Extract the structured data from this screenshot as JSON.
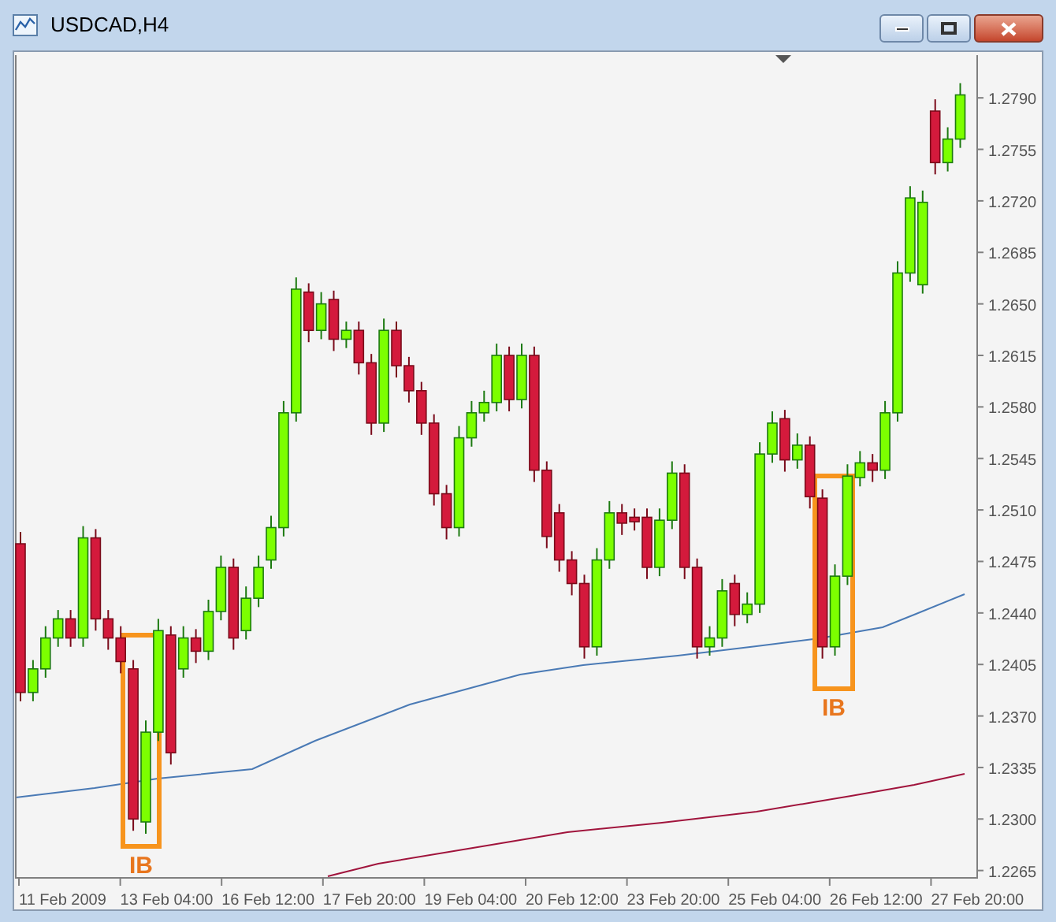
{
  "window": {
    "title": "USDCAD,H4"
  },
  "chart_data": {
    "type": "candlestick",
    "ylim": [
      1.226,
      1.2819
    ],
    "yticks": [
      {
        "value": 1.279,
        "label": "1.2790"
      },
      {
        "value": 1.2755,
        "label": "1.2755"
      },
      {
        "value": 1.272,
        "label": "1.2720"
      },
      {
        "value": 1.2685,
        "label": "1.2685"
      },
      {
        "value": 1.265,
        "label": "1.2650"
      },
      {
        "value": 1.2615,
        "label": "1.2615"
      },
      {
        "value": 1.258,
        "label": "1.2580"
      },
      {
        "value": 1.2545,
        "label": "1.2545"
      },
      {
        "value": 1.251,
        "label": "1.2510"
      },
      {
        "value": 1.2475,
        "label": "1.2475"
      },
      {
        "value": 1.244,
        "label": "1.2440"
      },
      {
        "value": 1.2405,
        "label": "1.2405"
      },
      {
        "value": 1.237,
        "label": "1.2370"
      },
      {
        "value": 1.2335,
        "label": "1.2335"
      },
      {
        "value": 1.23,
        "label": "1.2300"
      },
      {
        "value": 1.2265,
        "label": "1.2265"
      }
    ],
    "ohlc": [
      [
        1.2487,
        1.2495,
        1.238,
        1.2386
      ],
      [
        1.2386,
        1.2408,
        1.238,
        1.2402
      ],
      [
        1.2402,
        1.2431,
        1.2396,
        1.2423
      ],
      [
        1.2423,
        1.2442,
        1.2417,
        1.2436
      ],
      [
        1.2436,
        1.2442,
        1.2417,
        1.2423
      ],
      [
        1.2423,
        1.2499,
        1.2417,
        1.2491
      ],
      [
        1.2491,
        1.2497,
        1.2428,
        1.2436
      ],
      [
        1.2436,
        1.2442,
        1.2415,
        1.2423
      ],
      [
        1.2423,
        1.2431,
        1.2399,
        1.2407
      ],
      [
        1.2402,
        1.2408,
        1.2292,
        1.23
      ],
      [
        1.2298,
        1.2367,
        1.229,
        1.2359
      ],
      [
        1.2359,
        1.2436,
        1.2353,
        1.2428
      ],
      [
        1.2425,
        1.2431,
        1.2337,
        1.2345
      ],
      [
        1.2402,
        1.2431,
        1.2396,
        1.2423
      ],
      [
        1.2423,
        1.2429,
        1.2406,
        1.2414
      ],
      [
        1.2414,
        1.2449,
        1.2408,
        1.2441
      ],
      [
        1.2441,
        1.2479,
        1.2435,
        1.2471
      ],
      [
        1.2471,
        1.2477,
        1.2415,
        1.2423
      ],
      [
        1.2428,
        1.2458,
        1.2422,
        1.245
      ],
      [
        1.245,
        1.2479,
        1.2444,
        1.2471
      ],
      [
        1.2476,
        1.2506,
        1.247,
        1.2498
      ],
      [
        1.2498,
        1.2584,
        1.2492,
        1.2576
      ],
      [
        1.2576,
        1.2668,
        1.257,
        1.266
      ],
      [
        1.2658,
        1.2664,
        1.2624,
        1.2632
      ],
      [
        1.2632,
        1.2658,
        1.2626,
        1.265
      ],
      [
        1.2653,
        1.2659,
        1.2618,
        1.2626
      ],
      [
        1.2626,
        1.2638,
        1.262,
        1.2632
      ],
      [
        1.2632,
        1.2638,
        1.2602,
        1.261
      ],
      [
        1.261,
        1.2616,
        1.2561,
        1.2569
      ],
      [
        1.2569,
        1.264,
        1.2563,
        1.2632
      ],
      [
        1.2632,
        1.2638,
        1.26,
        1.2608
      ],
      [
        1.2608,
        1.2614,
        1.2583,
        1.2591
      ],
      [
        1.2591,
        1.2597,
        1.2561,
        1.2569
      ],
      [
        1.2569,
        1.2575,
        1.2513,
        1.2521
      ],
      [
        1.2521,
        1.2527,
        1.249,
        1.2498
      ],
      [
        1.2498,
        1.2567,
        1.2492,
        1.2559
      ],
      [
        1.2559,
        1.2584,
        1.2553,
        1.2576
      ],
      [
        1.2576,
        1.2591,
        1.257,
        1.2583
      ],
      [
        1.2583,
        1.2623,
        1.2577,
        1.2615
      ],
      [
        1.2615,
        1.2621,
        1.2577,
        1.2585
      ],
      [
        1.2585,
        1.2623,
        1.2579,
        1.2615
      ],
      [
        1.2615,
        1.2621,
        1.2529,
        1.2537
      ],
      [
        1.2537,
        1.2543,
        1.2484,
        1.2492
      ],
      [
        1.2508,
        1.2514,
        1.2468,
        1.2476
      ],
      [
        1.2476,
        1.2482,
        1.2452,
        1.246
      ],
      [
        1.246,
        1.2466,
        1.2409,
        1.2417
      ],
      [
        1.2417,
        1.2484,
        1.2411,
        1.2476
      ],
      [
        1.2476,
        1.2516,
        1.247,
        1.2508
      ],
      [
        1.2508,
        1.2514,
        1.2493,
        1.2501
      ],
      [
        1.2505,
        1.2511,
        1.2496,
        1.2502
      ],
      [
        1.2505,
        1.2511,
        1.2463,
        1.2471
      ],
      [
        1.2471,
        1.2511,
        1.2465,
        1.2503
      ],
      [
        1.2503,
        1.2543,
        1.2497,
        1.2535
      ],
      [
        1.2535,
        1.2541,
        1.2463,
        1.2471
      ],
      [
        1.2471,
        1.2477,
        1.2409,
        1.2417
      ],
      [
        1.2417,
        1.2431,
        1.2411,
        1.2423
      ],
      [
        1.2423,
        1.2463,
        1.2417,
        1.2455
      ],
      [
        1.246,
        1.2466,
        1.2431,
        1.2439
      ],
      [
        1.2439,
        1.2454,
        1.2433,
        1.2446
      ],
      [
        1.2446,
        1.2556,
        1.244,
        1.2548
      ],
      [
        1.2548,
        1.2577,
        1.2542,
        1.2569
      ],
      [
        1.2572,
        1.2578,
        1.2536,
        1.2544
      ],
      [
        1.2544,
        1.2562,
        1.2538,
        1.2554
      ],
      [
        1.2554,
        1.256,
        1.2511,
        1.2519
      ],
      [
        1.2518,
        1.2524,
        1.2409,
        1.2417
      ],
      [
        1.2417,
        1.2473,
        1.2411,
        1.2465
      ],
      [
        1.2465,
        1.2541,
        1.2459,
        1.2533
      ],
      [
        1.2532,
        1.255,
        1.2526,
        1.2542
      ],
      [
        1.2542,
        1.2548,
        1.2529,
        1.2537
      ],
      [
        1.2537,
        1.2584,
        1.2531,
        1.2576
      ],
      [
        1.2576,
        1.2679,
        1.257,
        1.2671
      ],
      [
        1.2671,
        1.273,
        1.2665,
        1.2722
      ],
      [
        1.2663,
        1.2727,
        1.2657,
        1.2719
      ],
      [
        1.2781,
        1.2789,
        1.2738,
        1.2746
      ],
      [
        1.2746,
        1.277,
        1.274,
        1.2762
      ],
      [
        1.2762,
        1.28,
        1.2756,
        1.2792
      ]
    ]
  },
  "time_axis": {
    "labels": [
      "11 Feb 2009",
      "13 Feb 04:00",
      "16 Feb 12:00",
      "17 Feb 20:00",
      "19 Feb 04:00",
      "20 Feb 12:00",
      "23 Feb 20:00",
      "25 Feb 04:00",
      "26 Feb 12:00",
      "27 Feb 20:00"
    ]
  },
  "annotations": [
    {
      "label": "IB"
    },
    {
      "label": "IB"
    }
  ]
}
